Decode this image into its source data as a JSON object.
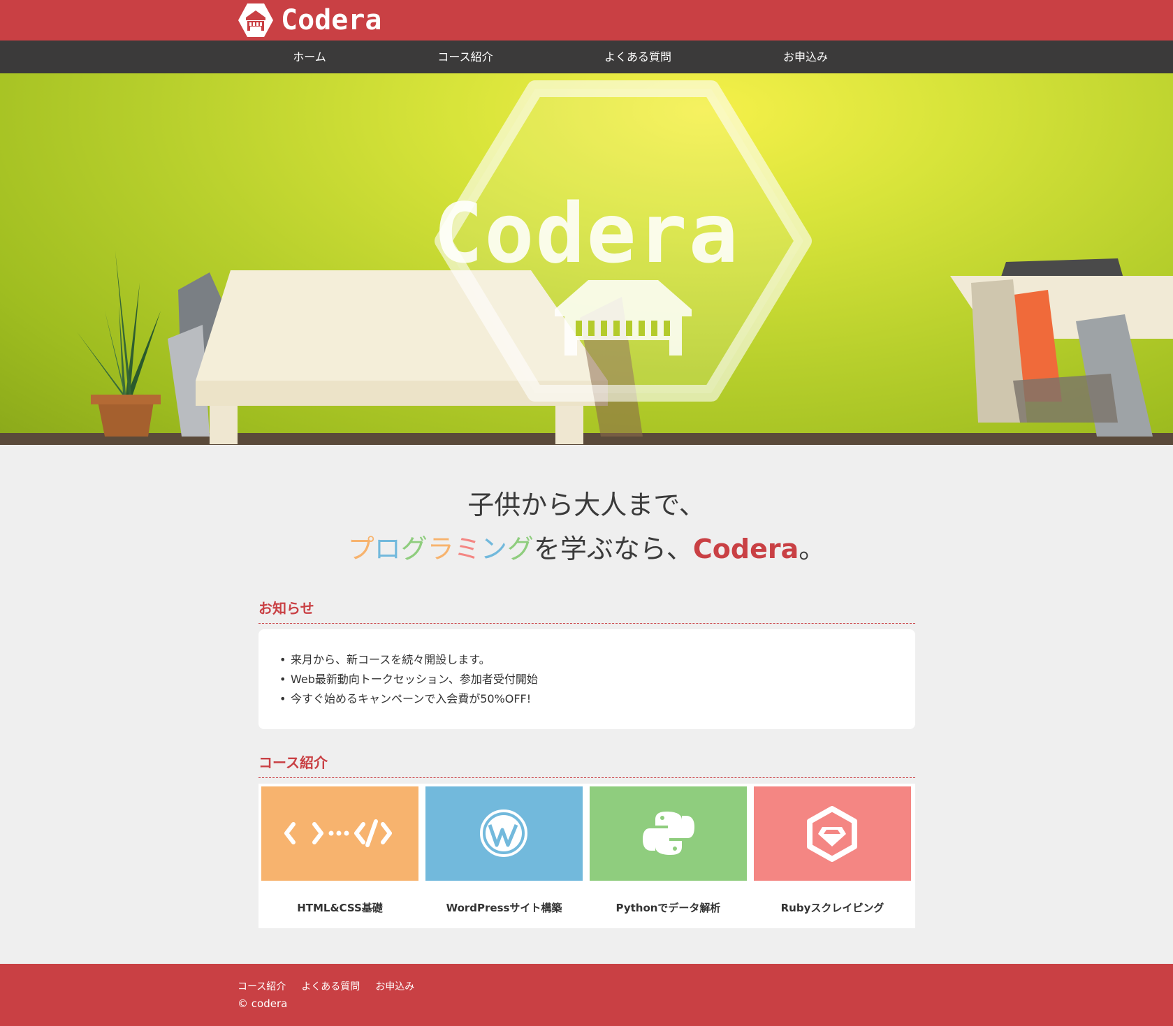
{
  "header": {
    "brand_name": "Codera"
  },
  "nav": {
    "items": [
      "ホーム",
      "コース紹介",
      "よくある質問",
      "お申込み"
    ]
  },
  "hero": {
    "title": "Codera"
  },
  "tagline": {
    "line1": "子供から大人まで、",
    "line2_chars": [
      "プ",
      "ロ",
      "グ",
      "ラ",
      "ミ",
      "ン",
      "グ"
    ],
    "line2_rest": "を学ぶなら、",
    "line2_brand": "Codera",
    "line2_end": "。"
  },
  "news": {
    "title": "お知らせ",
    "items": [
      "来月から、新コースを続々開設します。",
      "Web最新動向トークセッション、参加者受付開始",
      "今すぐ始めるキャンペーンで入会費が50%OFF!"
    ]
  },
  "courses": {
    "title": "コース紹介",
    "items": [
      {
        "label": "HTML&CSS基礎",
        "icon": "code-icon",
        "color": "#f7b36e"
      },
      {
        "label": "WordPressサイト構築",
        "icon": "wordpress-icon",
        "color": "#72b9dc"
      },
      {
        "label": "Pythonでデータ解析",
        "icon": "python-icon",
        "color": "#8fcd7e"
      },
      {
        "label": "Rubyスクレイピング",
        "icon": "ruby-icon",
        "color": "#f48683"
      }
    ]
  },
  "footer": {
    "links": [
      "コース紹介",
      "よくある質問",
      "お申込み"
    ],
    "copyright": "© codera"
  },
  "colors": {
    "brand": "#c94044",
    "nav": "#3b3a3a",
    "tag_chars": [
      "#f7b36e",
      "#72b9dc",
      "#8fcd7e",
      "#f7b36e",
      "#f48683",
      "#72b9dc",
      "#8fcd7e"
    ]
  }
}
